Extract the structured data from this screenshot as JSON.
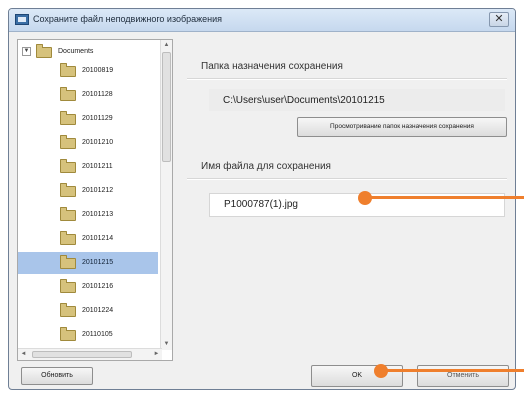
{
  "window": {
    "title": "Сохраните файл неподвижного изображения",
    "close_label": "✕"
  },
  "tree": {
    "root_label": "Documents",
    "expander_label": "▼",
    "items": [
      {
        "label": "20100819",
        "selected": false
      },
      {
        "label": "20101128",
        "selected": false
      },
      {
        "label": "20101129",
        "selected": false
      },
      {
        "label": "20101210",
        "selected": false
      },
      {
        "label": "20101211",
        "selected": false
      },
      {
        "label": "20101212",
        "selected": false
      },
      {
        "label": "20101213",
        "selected": false
      },
      {
        "label": "20101214",
        "selected": false
      },
      {
        "label": "20101215",
        "selected": true
      },
      {
        "label": "20101216",
        "selected": false
      },
      {
        "label": "20101224",
        "selected": false
      },
      {
        "label": "20110105",
        "selected": false
      }
    ],
    "scroll_up": "▲",
    "scroll_down": "▼",
    "scroll_left": "◄",
    "scroll_right": "►",
    "refresh_label": "Обновить"
  },
  "destination": {
    "section_label": "Папка назначения сохранения",
    "path": "C:\\Users\\user\\Documents\\20101215",
    "change_button_label": "Просмотривание папок назначения сохранения"
  },
  "file": {
    "section_label": "Имя файла для сохранения",
    "value": "P1000787(1).jpg"
  },
  "actions": {
    "ok_label": "OK",
    "cancel_label": "Отменить"
  },
  "colors": {
    "callout": "#ef7f2d",
    "selection": "#a9c5ea"
  }
}
